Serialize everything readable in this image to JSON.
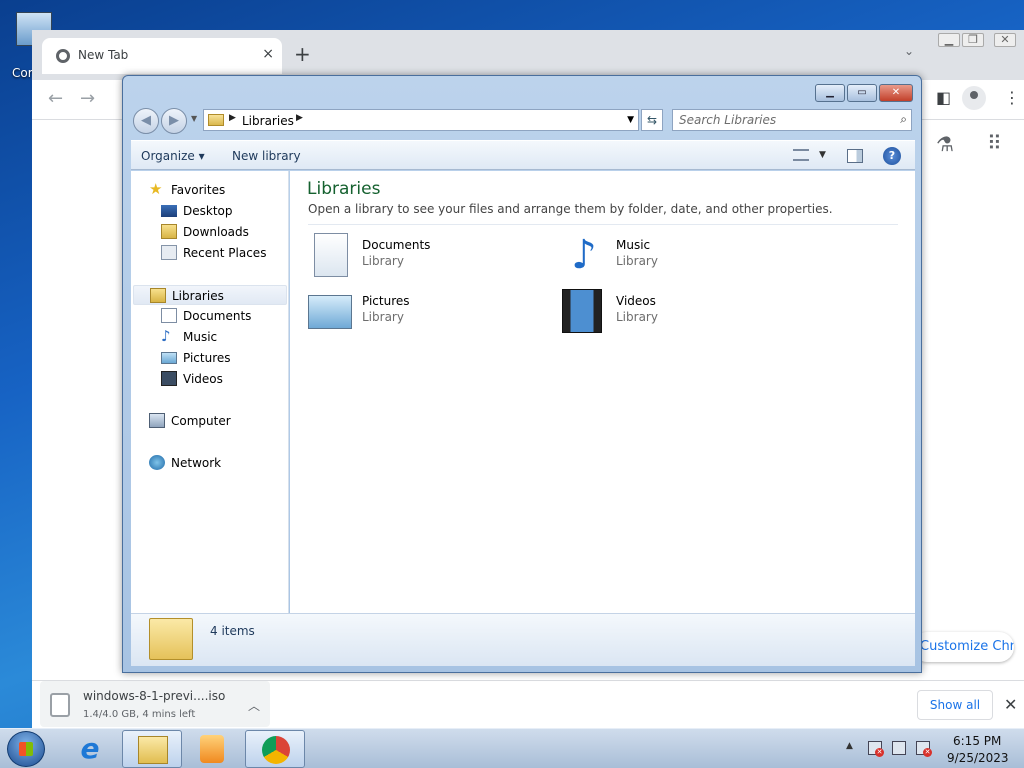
{
  "desktop": {
    "icon_label": "Cor"
  },
  "chrome": {
    "tab_title": "New Tab",
    "tab_close": "×",
    "new_tab": "+",
    "tab_dropdown": "⌄",
    "customize_label": "Customize Chrome"
  },
  "explorer": {
    "address_crumb": "Libraries",
    "search_placeholder": "Search Libraries",
    "commands": {
      "organize": "Organize",
      "new_library": "New library"
    },
    "nav": {
      "favorites": "Favorites",
      "desktop": "Desktop",
      "downloads": "Downloads",
      "recent_places": "Recent Places",
      "libraries": "Libraries",
      "documents": "Documents",
      "music": "Music",
      "pictures": "Pictures",
      "videos": "Videos",
      "computer": "Computer",
      "network": "Network"
    },
    "content": {
      "title": "Libraries",
      "subtitle": "Open a library to see your files and arrange them by folder, date, and other properties.",
      "libraries": [
        {
          "name": "Documents",
          "type": "Library"
        },
        {
          "name": "Music",
          "type": "Library"
        },
        {
          "name": "Pictures",
          "type": "Library"
        },
        {
          "name": "Videos",
          "type": "Library"
        }
      ]
    },
    "details": {
      "item_count": "4 items"
    }
  },
  "download_shelf": {
    "file_name": "windows-8-1-previ....iso",
    "status": "1.4/4.0 GB, 4 mins left",
    "show_all": "Show all"
  },
  "taskbar": {
    "time": "6:15 PM",
    "date": "9/25/2023"
  },
  "colors": {
    "library_title": "#15612f",
    "link_blue": "#1a73e8"
  }
}
